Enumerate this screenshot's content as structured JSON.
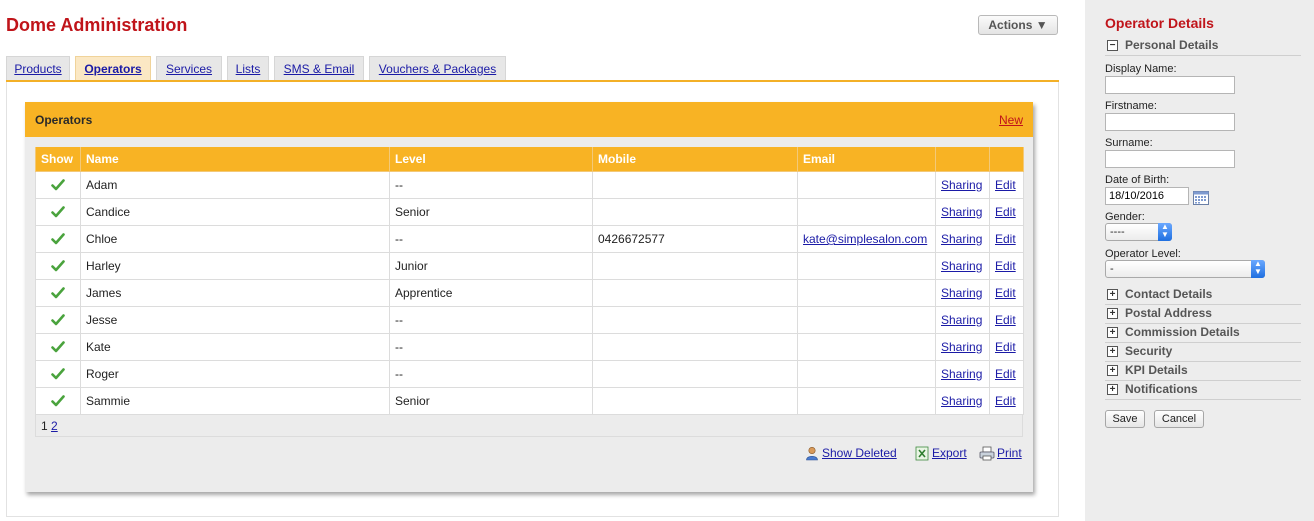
{
  "header": {
    "title": "Dome Administration",
    "actions_label": "Actions ▼"
  },
  "tabs": [
    {
      "label": "Products",
      "active": false
    },
    {
      "label": "Operators",
      "active": true
    },
    {
      "label": "Services",
      "active": false
    },
    {
      "label": "Lists",
      "active": false
    },
    {
      "label": "SMS & Email",
      "active": false
    },
    {
      "label": "Vouchers & Packages",
      "active": false
    }
  ],
  "operators_panel": {
    "title": "Operators",
    "new_label": "New",
    "columns": [
      "Show",
      "Name",
      "Level",
      "Mobile",
      "Email",
      "",
      ""
    ],
    "rows": [
      {
        "name": "Adam",
        "level": "--",
        "mobile": "",
        "email": "",
        "sharing": "Sharing",
        "edit": "Edit"
      },
      {
        "name": "Candice",
        "level": "Senior",
        "mobile": "",
        "email": "",
        "sharing": "Sharing",
        "edit": "Edit"
      },
      {
        "name": "Chloe",
        "level": "--",
        "mobile": "0426672577",
        "email": "kate@simplesalon.com",
        "sharing": "Sharing",
        "edit": "Edit"
      },
      {
        "name": "Harley",
        "level": "Junior",
        "mobile": "",
        "email": "",
        "sharing": "Sharing",
        "edit": "Edit"
      },
      {
        "name": "James",
        "level": "Apprentice",
        "mobile": "",
        "email": "",
        "sharing": "Sharing",
        "edit": "Edit"
      },
      {
        "name": "Jesse",
        "level": "--",
        "mobile": "",
        "email": "",
        "sharing": "Sharing",
        "edit": "Edit"
      },
      {
        "name": "Kate",
        "level": "--",
        "mobile": "",
        "email": "",
        "sharing": "Sharing",
        "edit": "Edit"
      },
      {
        "name": "Roger",
        "level": "--",
        "mobile": "",
        "email": "",
        "sharing": "Sharing",
        "edit": "Edit"
      },
      {
        "name": "Sammie",
        "level": "Senior",
        "mobile": "",
        "email": "",
        "sharing": "Sharing",
        "edit": "Edit"
      }
    ],
    "pagination": {
      "current": "1",
      "other": "2"
    },
    "footer_links": {
      "show_deleted": "Show Deleted",
      "export": "Export",
      "print": "Print"
    }
  },
  "sidebar": {
    "title": "Operator Details",
    "personal_details": "Personal Details",
    "fields": {
      "display_name_label": "Display Name:",
      "display_name_value": "",
      "firstname_label": "Firstname:",
      "firstname_value": "",
      "surname_label": "Surname:",
      "surname_value": "",
      "dob_label": "Date of Birth:",
      "dob_value": "18/10/2016",
      "gender_label": "Gender:",
      "gender_value": "----",
      "operator_level_label": "Operator Level:",
      "operator_level_value": "-"
    },
    "collapsed_sections": [
      "Contact Details",
      "Postal Address",
      "Commission Details",
      "Security",
      "KPI Details",
      "Notifications"
    ],
    "save_label": "Save",
    "cancel_label": "Cancel"
  },
  "colors": {
    "accent": "#f8b324",
    "title_red": "#c0141a",
    "link": "#1a1aa6"
  }
}
